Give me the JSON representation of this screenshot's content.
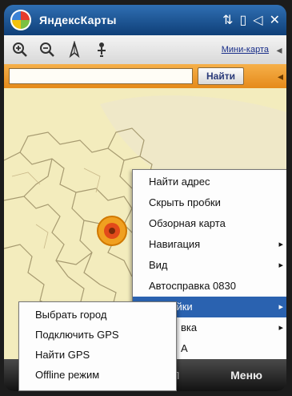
{
  "titlebar": {
    "app_title": "ЯндексКарты"
  },
  "toolbar": {
    "map_type_link": "Мини-карта"
  },
  "search": {
    "input_value": "",
    "find_button": "Найти"
  },
  "main_menu": {
    "items": [
      {
        "label": "Найти адрес",
        "submenu": false
      },
      {
        "label": "Скрыть пробки",
        "submenu": false
      },
      {
        "label": "Обзорная карта",
        "submenu": false
      },
      {
        "label": "Навигация",
        "submenu": true
      },
      {
        "label": "Вид",
        "submenu": true
      },
      {
        "label": "Автосправка 0830",
        "submenu": false
      },
      {
        "label": "ройки",
        "submenu": true,
        "active": true
      },
      {
        "label": "вка",
        "submenu": true
      },
      {
        "label": "А",
        "submenu": false
      }
    ]
  },
  "sub_menu": {
    "items": [
      {
        "label": "Выбрать город"
      },
      {
        "label": "Подключить GPS"
      },
      {
        "label": "Найти GPS"
      },
      {
        "label": "Offline режим"
      }
    ]
  },
  "softkeys": {
    "left": "П",
    "right": "Меню"
  },
  "colors": {
    "titlebar": "#1f5a9e",
    "search_bar": "#f0a030",
    "map_background": "#f3ecbd",
    "menu_highlight": "#2a62b0"
  }
}
